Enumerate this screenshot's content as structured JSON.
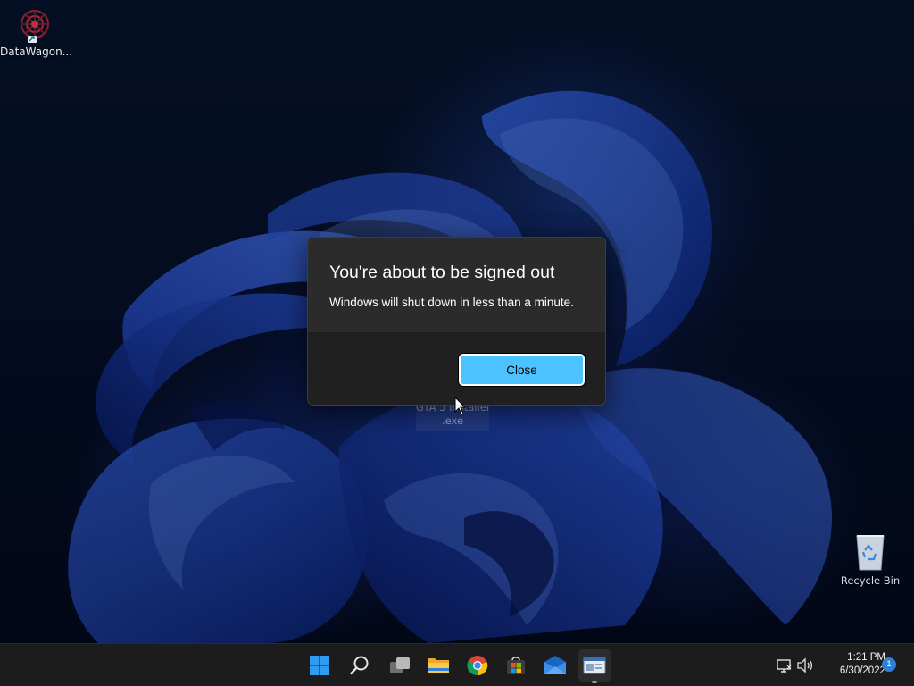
{
  "desktop": {
    "icons": [
      {
        "label": "DataWagon..."
      },
      {
        "label_line1": "GTA 5 Installer",
        "label_line2": ".exe"
      },
      {
        "label": "Recycle Bin"
      }
    ]
  },
  "dialog": {
    "title": "You're about to be signed out",
    "message": "Windows will shut down in less than a minute.",
    "close_label": "Close"
  },
  "taskbar": {
    "apps": [
      {
        "icon": "windows-start-icon"
      },
      {
        "icon": "search-icon"
      },
      {
        "icon": "task-view-icon"
      },
      {
        "icon": "file-explorer-icon"
      },
      {
        "icon": "chrome-icon"
      },
      {
        "icon": "store-icon"
      },
      {
        "icon": "mail-icon"
      },
      {
        "icon": "app-window-icon"
      }
    ],
    "tray": {
      "time": "1:21 PM",
      "date": "6/30/2022",
      "notification_count": "1"
    }
  },
  "colors": {
    "accent": "#4cc2ff",
    "dialog_bg": "#2b2b2b",
    "dialog_footer": "#202020",
    "taskbar_bg": "#1c1c1c"
  }
}
